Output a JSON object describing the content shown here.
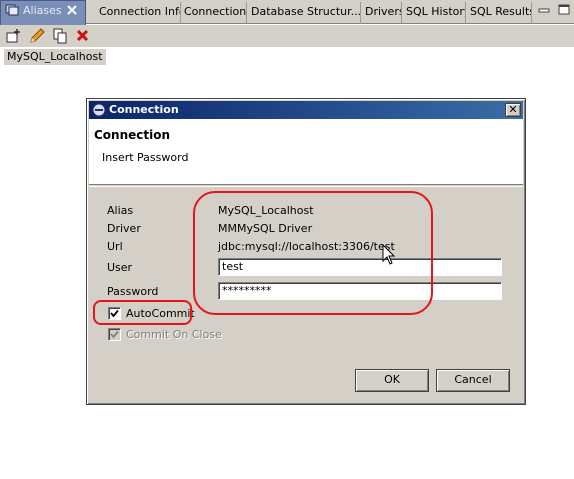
{
  "tabs": [
    {
      "label": "Aliases",
      "icon": "aliases-icon",
      "active": true
    },
    {
      "label": "Connection Info"
    },
    {
      "label": "Connections"
    },
    {
      "label": "Database Structur..."
    },
    {
      "label": "Drivers"
    },
    {
      "label": "SQL History"
    },
    {
      "label": "SQL Results"
    }
  ],
  "window_controls": [
    "minimize-icon",
    "maximize-icon"
  ],
  "toolbar_icons": [
    "new-alias-icon",
    "edit-alias-icon",
    "copy-alias-icon",
    "delete-alias-icon"
  ],
  "alias_list": [
    "MySQL_Localhost"
  ],
  "dialog": {
    "window_title": "Connection",
    "close_glyph": "✕",
    "header_title": "Connection",
    "header_message": "Insert Password",
    "labels": {
      "alias": "Alias",
      "driver": "Driver",
      "url": "Url",
      "user": "User",
      "password": "Password"
    },
    "values": {
      "alias": "MySQL_Localhost",
      "driver": "MMMySQL Driver",
      "url": "jdbc:mysql://localhost:3306/test",
      "user": "test",
      "password": "*********"
    },
    "autocommit": {
      "label": "AutoCommit",
      "checked": true
    },
    "commit_on_close": {
      "label": "Commit On Close",
      "checked": true,
      "enabled": false
    },
    "buttons": {
      "ok": "OK",
      "cancel": "Cancel"
    }
  },
  "colors": {
    "chrome": "#d4d0c8",
    "title_gradient_start": "#0a246a",
    "title_gradient_end": "#3a6ea5",
    "annotation_red": "#e8141c",
    "active_tab": "#7a8fb8"
  }
}
